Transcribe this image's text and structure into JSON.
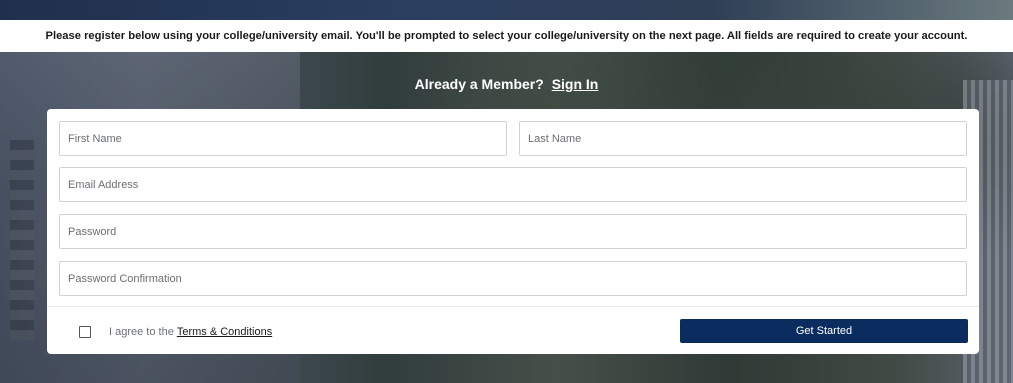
{
  "notice": {
    "text": "Please register below using your college/university email. You'll be prompted to select your college/university on the next page. All fields are required to create your account."
  },
  "member": {
    "prompt": "Already a Member?",
    "signin_label": "Sign In"
  },
  "form": {
    "first_name_placeholder": "First Name",
    "last_name_placeholder": "Last Name",
    "email_placeholder": "Email Address",
    "password_placeholder": "Password",
    "password_confirm_placeholder": "Password Confirmation",
    "agree_prefix": "I agree to the",
    "terms_label": "Terms & Conditions",
    "submit_label": "Get Started"
  },
  "colors": {
    "button_bg": "#0a2c5f",
    "notice_bg": "#ffffff"
  }
}
